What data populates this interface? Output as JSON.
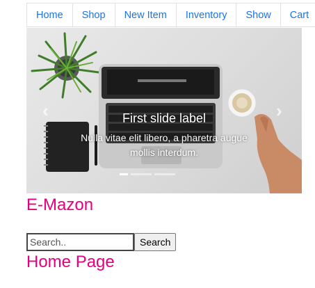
{
  "nav": {
    "items": [
      {
        "label": "Home"
      },
      {
        "label": "Shop"
      },
      {
        "label": "New Item"
      },
      {
        "label": "Inventory"
      },
      {
        "label": "Show"
      },
      {
        "label": "Cart"
      }
    ]
  },
  "carousel": {
    "title": "First slide label",
    "text": "Nulla vitae elit libero, a pharetra augue mollis interdum.",
    "prev_icon": "chevron-left-icon",
    "next_icon": "chevron-right-icon",
    "slide_count": 3,
    "active_slide": 1,
    "prev_glyph": "‹",
    "next_glyph": "›"
  },
  "brand": {
    "name": "E-Mazon",
    "color": "#e6007e"
  },
  "search": {
    "placeholder": "Search..",
    "button_label": "Search"
  },
  "page": {
    "title": "Home Page"
  },
  "colors": {
    "link": "#1a73e8",
    "accent": "#e6007e"
  }
}
